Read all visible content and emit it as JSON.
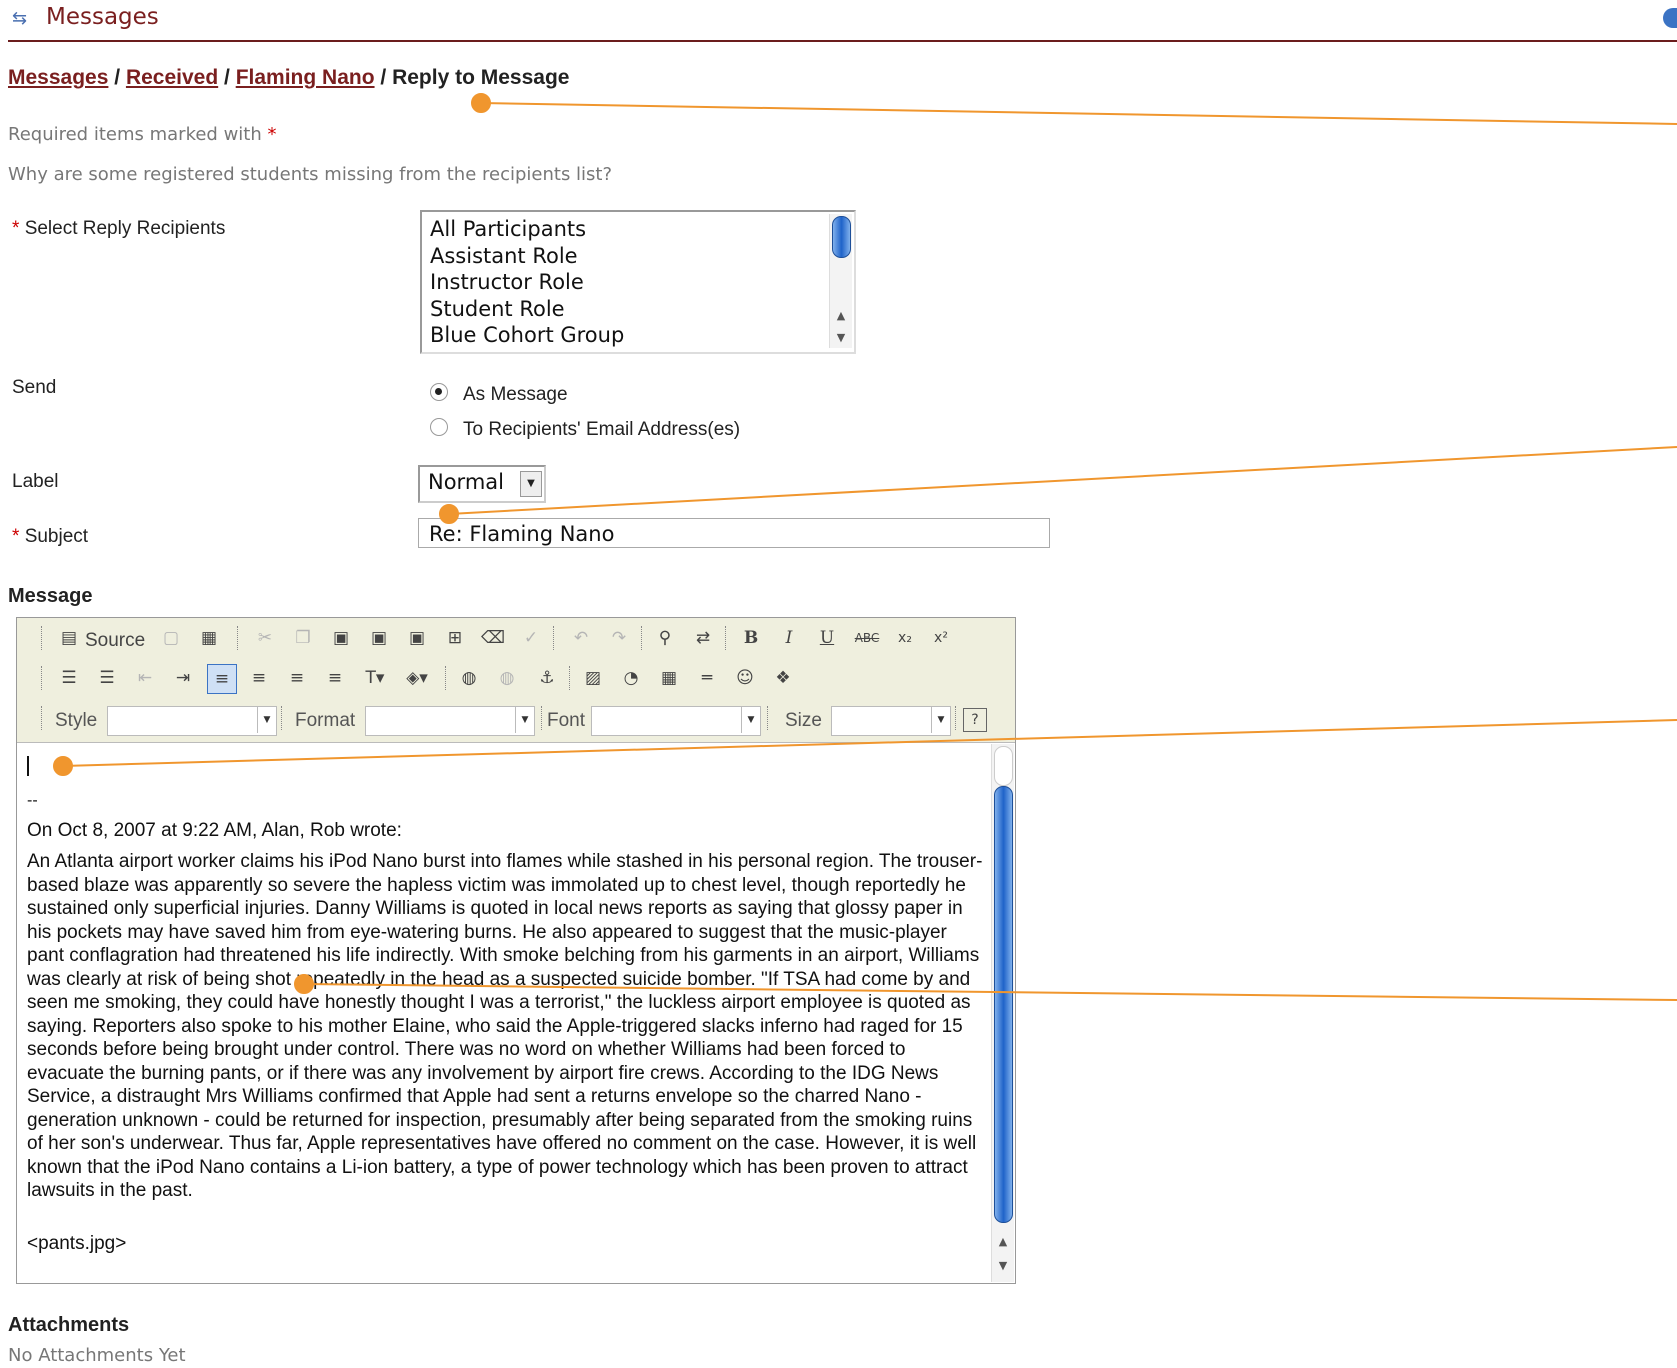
{
  "header": {
    "title": "Messages",
    "icon": "messages-icon"
  },
  "breadcrumb": {
    "items": [
      "Messages",
      "Received",
      "Flaming Nano"
    ],
    "separator": "/",
    "current": "Reply to Message"
  },
  "required_note": {
    "text": "Required items marked with",
    "star": "*"
  },
  "missing_note": "Why are some registered students missing from the recipients list?",
  "fields": {
    "recipients": {
      "label": "Select Reply Recipients",
      "options": [
        "All Participants",
        "Assistant Role",
        "Instructor Role",
        "Student Role",
        "Blue Cohort Group"
      ]
    },
    "send": {
      "label": "Send",
      "options": [
        {
          "label": "As Message",
          "selected": true
        },
        {
          "label": "To Recipients' Email Address(es)",
          "selected": false
        }
      ]
    },
    "label": {
      "label": "Label",
      "value": "Normal"
    },
    "subject": {
      "label": "Subject",
      "value": "Re: Flaming Nano"
    }
  },
  "message": {
    "title": "Message",
    "toolbar": {
      "row1": [
        "Source",
        "cut",
        "copy",
        "paste",
        "paste-text",
        "paste-word",
        "print",
        "spellcheck",
        "undo",
        "redo",
        "find",
        "replace",
        "select-all",
        "remove-format",
        "bold",
        "italic",
        "underline",
        "strike",
        "subscript",
        "superscript"
      ],
      "style_label": "Style",
      "format_label": "Format",
      "font_label": "Font",
      "size_label": "Size"
    },
    "dashes": "--",
    "intro": "On Oct 8, 2007 at 9:22 AM, Alan, Rob wrote:",
    "quote": "An Atlanta airport worker claims his iPod Nano burst into flames while stashed in his personal region. The trouser-based blaze was apparently so severe the hapless victim was immolated up to chest level, though reportedly he sustained only superficial injuries. Danny Williams is quoted in local news reports as saying that glossy paper in his pockets may have saved him from eye-watering burns. He also appeared to suggest that the music-player pant conflagration had threatened his life indirectly. With smoke belching from his garments in an airport, Williams was clearly at risk of being shot repeatedly in the head as a suspected suicide bomber. \"If TSA had come by and seen me smoking, they could have honestly thought I was a terrorist,\" the luckless airport employee is quoted as saying. Reporters also spoke to his mother Elaine, who said the Apple-triggered slacks inferno had raged for 15 seconds before being brought under control. There was no word on whether Williams had been forced to evacuate the burning pants, or if there was any involvement by airport fire crews. According to the IDG News Service, a distraught Mrs Williams confirmed that Apple had sent a returns envelope so the charred Nano - generation unknown - could be returned for inspection, presumably after being separated from the smoking ruins of her son's underwear. Thus far, Apple representatives have offered no comment on the case. However, it is well known that the iPod Nano contains a Li-ion battery, a type of power technology which has been proven to attract lawsuits in the past.",
    "attachment_ref": "<pants.jpg>"
  },
  "attachments": {
    "title": "Attachments",
    "empty": "No Attachments Yet"
  },
  "colors": {
    "accent": "#7a1f1f",
    "callout": "#f0962e",
    "scroll_blue": "#1f63c9"
  }
}
